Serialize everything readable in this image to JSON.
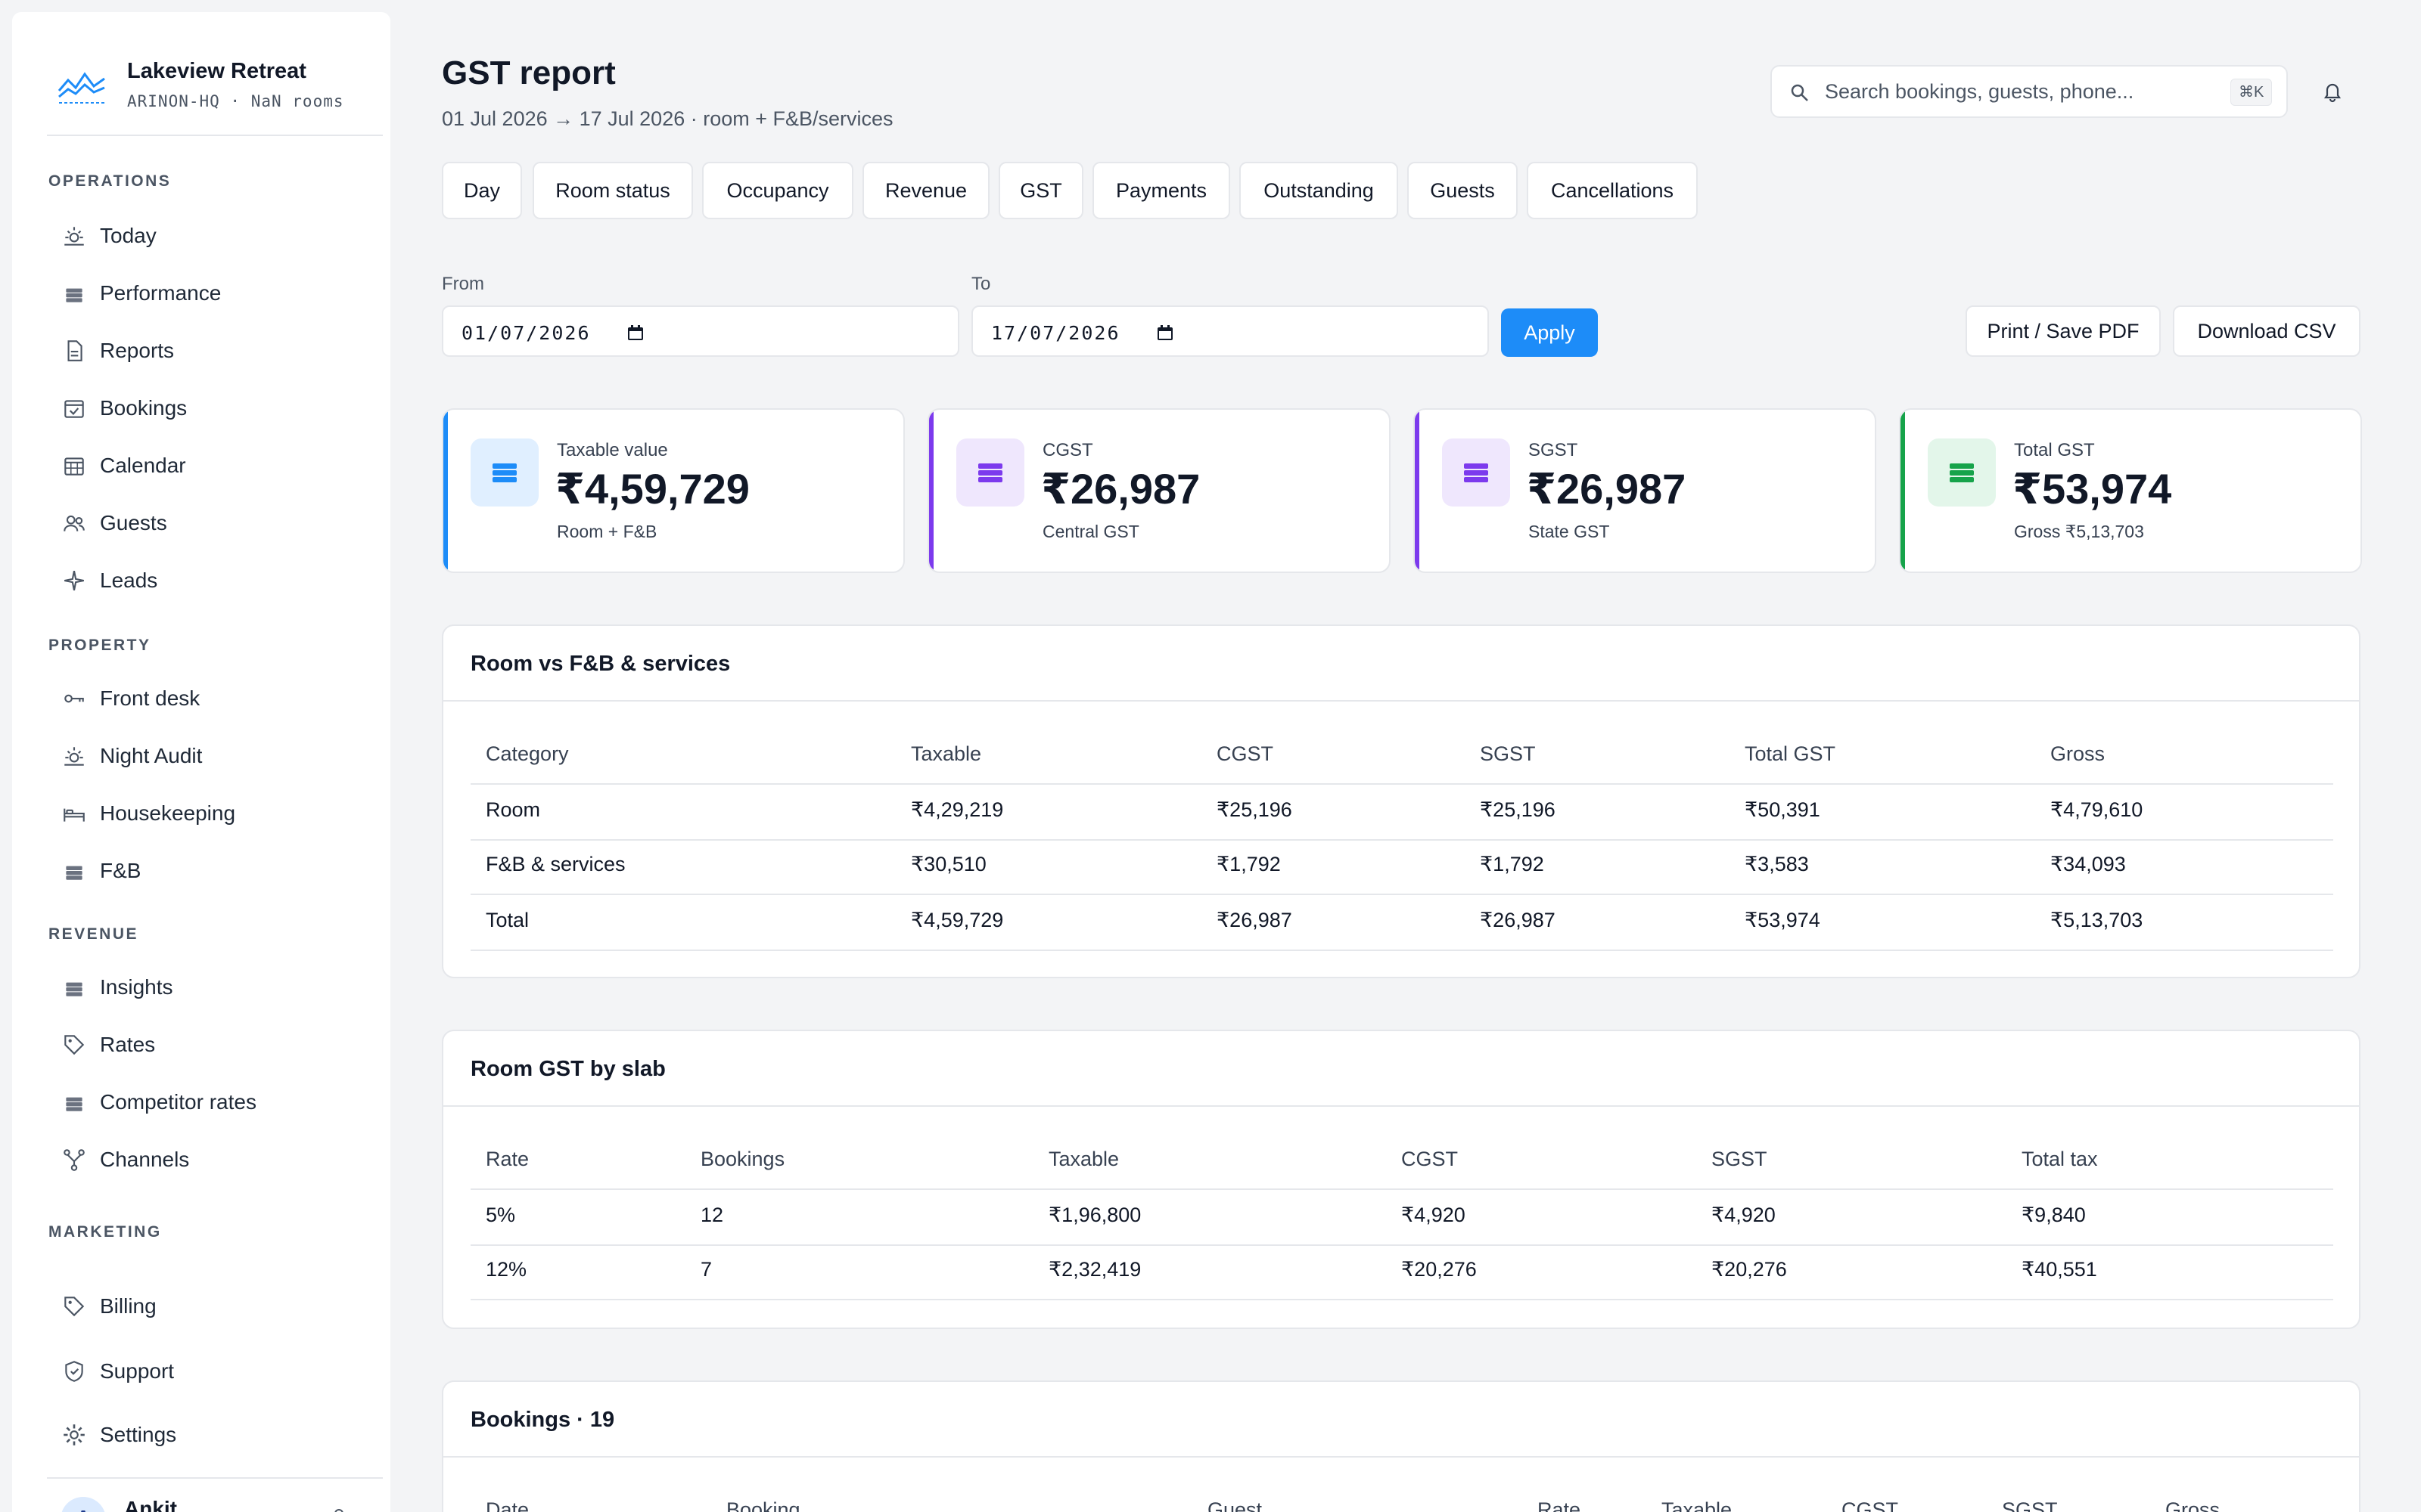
{
  "brand": {
    "name": "Lakeview Retreat",
    "sub": "ARINON-HQ · NaN rooms"
  },
  "sidebar": {
    "sections": [
      "OPERATIONS",
      "PROPERTY",
      "REVENUE",
      "MARKETING"
    ],
    "items": [
      {
        "label": "Today",
        "icon": "sun-icon"
      },
      {
        "label": "Performance",
        "icon": "stack-icon"
      },
      {
        "label": "Reports",
        "icon": "document-icon"
      },
      {
        "label": "Bookings",
        "icon": "calendar-check-icon"
      },
      {
        "label": "Calendar",
        "icon": "calendar-icon"
      },
      {
        "label": "Guests",
        "icon": "users-icon"
      },
      {
        "label": "Leads",
        "icon": "sparkle-icon"
      },
      {
        "label": "Front desk",
        "icon": "key-icon"
      },
      {
        "label": "Night Audit",
        "icon": "sun-icon"
      },
      {
        "label": "Housekeeping",
        "icon": "bed-icon"
      },
      {
        "label": "F&B",
        "icon": "stack-icon"
      },
      {
        "label": "Insights",
        "icon": "stack-icon"
      },
      {
        "label": "Rates",
        "icon": "tag-icon"
      },
      {
        "label": "Competitor rates",
        "icon": "stack-icon"
      },
      {
        "label": "Channels",
        "icon": "branch-icon"
      },
      {
        "label": "Billing",
        "icon": "tag-icon"
      },
      {
        "label": "Support",
        "icon": "shield-icon"
      },
      {
        "label": "Settings",
        "icon": "gear-icon"
      }
    ],
    "user": {
      "initial": "A",
      "name": "Ankit"
    }
  },
  "header": {
    "title": "GST report",
    "subtitle": "01 Jul 2026 → 17 Jul 2026 · room + F&B/services",
    "search_placeholder": "Search bookings, guests, phone...",
    "shortcut": "⌘K"
  },
  "tabs": [
    "Day",
    "Room status",
    "Occupancy",
    "Revenue",
    "GST",
    "Payments",
    "Outstanding",
    "Guests",
    "Cancellations"
  ],
  "filters": {
    "from_label": "From",
    "from_value": "01/07/2026",
    "to_label": "To",
    "to_value": "17/07/2026",
    "apply": "Apply",
    "print": "Print / Save PDF",
    "download": "Download CSV"
  },
  "stats": [
    {
      "label": "Taxable value",
      "value": "₹4,59,729",
      "sub": "Room + F&B",
      "color": "#1d8cf8"
    },
    {
      "label": "CGST",
      "value": "₹26,987",
      "sub": "Central GST",
      "color": "#7c3aed"
    },
    {
      "label": "SGST",
      "value": "₹26,987",
      "sub": "State GST",
      "color": "#7c3aed"
    },
    {
      "label": "Total GST",
      "value": "₹53,974",
      "sub": "Gross ₹5,13,703",
      "color": "#16a34a"
    }
  ],
  "split_table": {
    "title": "Room vs F&B & services",
    "columns": [
      "Category",
      "Taxable",
      "CGST",
      "SGST",
      "Total GST",
      "Gross"
    ],
    "rows": [
      [
        "Room",
        "₹4,29,219",
        "₹25,196",
        "₹25,196",
        "₹50,391",
        "₹4,79,610"
      ],
      [
        "F&B & services",
        "₹30,510",
        "₹1,792",
        "₹1,792",
        "₹3,583",
        "₹34,093"
      ],
      [
        "Total",
        "₹4,59,729",
        "₹26,987",
        "₹26,987",
        "₹53,974",
        "₹5,13,703"
      ]
    ]
  },
  "slab_table": {
    "title": "Room GST by slab",
    "columns": [
      "Rate",
      "Bookings",
      "Taxable",
      "CGST",
      "SGST",
      "Total tax"
    ],
    "rows": [
      [
        "5%",
        "12",
        "₹1,96,800",
        "₹4,920",
        "₹4,920",
        "₹9,840"
      ],
      [
        "12%",
        "7",
        "₹2,32,419",
        "₹20,276",
        "₹20,276",
        "₹40,551"
      ]
    ]
  },
  "bookings_table": {
    "title": "Bookings · 19",
    "columns": [
      "Date",
      "Booking",
      "Guest",
      "Rate",
      "Taxable",
      "CGST",
      "SGST",
      "Gross"
    ]
  }
}
